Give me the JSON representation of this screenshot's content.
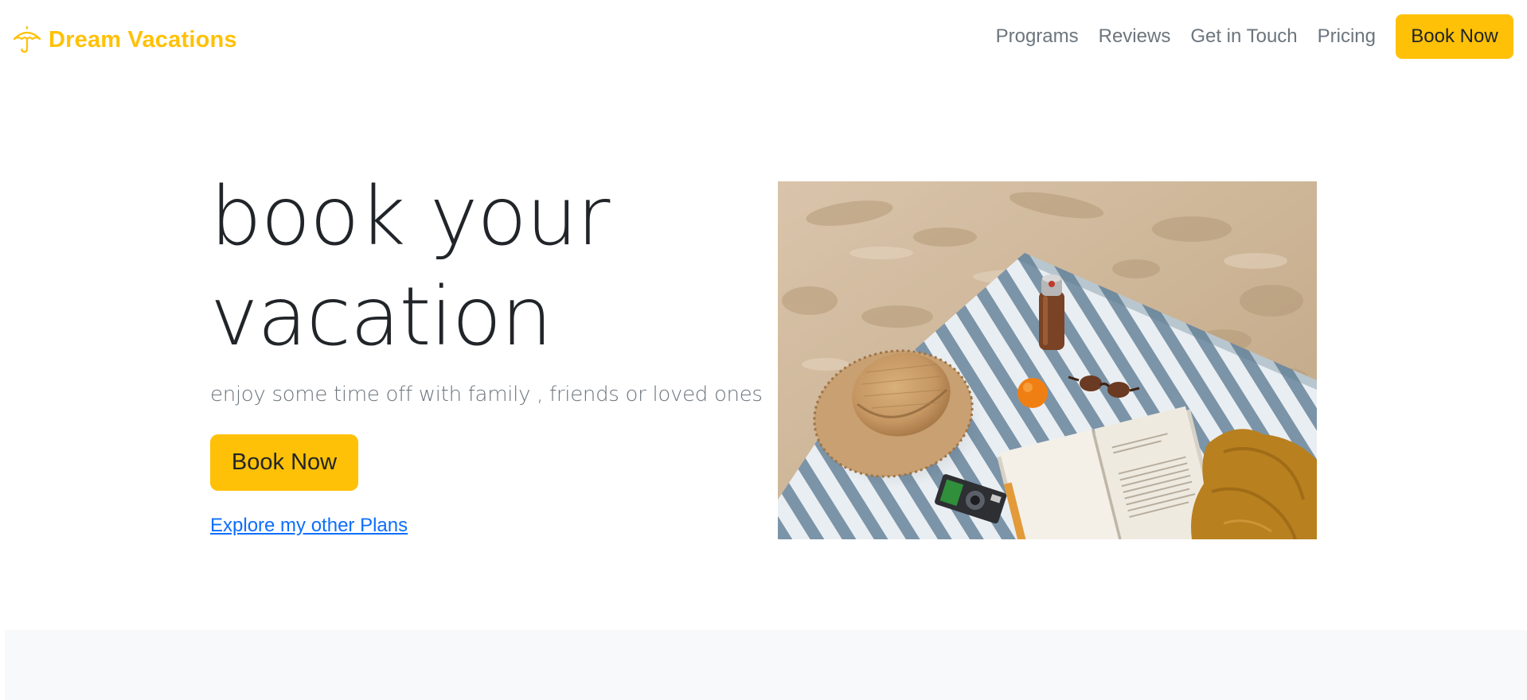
{
  "brand": {
    "name": "Dream Vacations",
    "icon": "umbrella-icon",
    "color": "#ffc107"
  },
  "nav": {
    "links": [
      "Programs",
      "Reviews",
      "Get in Touch",
      "Pricing"
    ],
    "cta_label": "Book Now"
  },
  "hero": {
    "title": "book your vacation",
    "subtitle": "enjoy some time off with family , friends or loved ones",
    "cta_label": "Book Now",
    "secondary_link": "Explore my other Plans",
    "image": "beach-picnic-photo"
  },
  "colors": {
    "accent": "#ffc107",
    "link": "#0d6efd",
    "muted_text": "#6c757d",
    "dark_text": "#212529",
    "section_bg": "#f8f9fa"
  }
}
